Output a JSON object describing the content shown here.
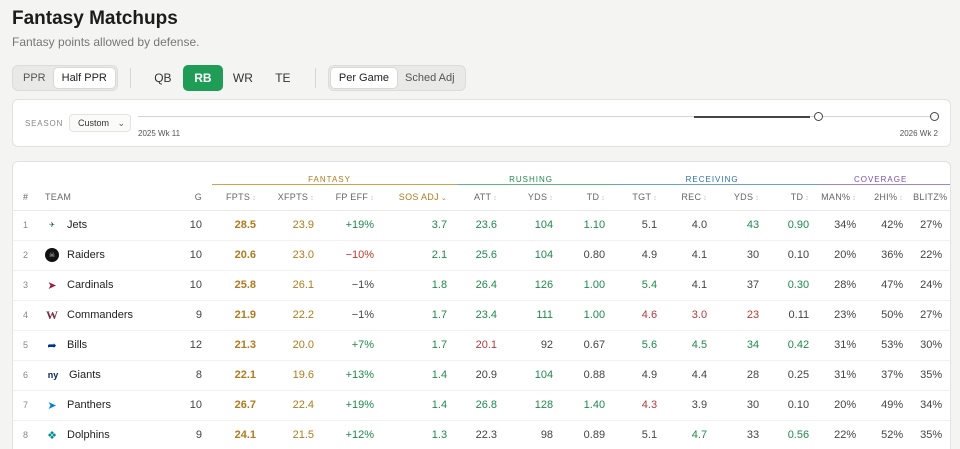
{
  "header": {
    "title": "Fantasy Matchups",
    "subtitle": "Fantasy points allowed by defense."
  },
  "toolbar": {
    "scoring": [
      {
        "label": "PPR",
        "active": false
      },
      {
        "label": "Half PPR",
        "active": true
      }
    ],
    "positions": [
      {
        "label": "QB",
        "active": false
      },
      {
        "label": "RB",
        "active": true
      },
      {
        "label": "WR",
        "active": false
      },
      {
        "label": "TE",
        "active": false
      }
    ],
    "mode": [
      {
        "label": "Per Game",
        "active": true
      },
      {
        "label": "Sched Adj",
        "active": false
      }
    ],
    "accent": "#1f9d57"
  },
  "season": {
    "label": "SEASON",
    "selected": "Custom",
    "range_min_label": "2025 Wk 11",
    "range_max_label": "2026 Wk 2"
  },
  "table": {
    "groups": {
      "fantasy": "FANTASY",
      "rushing": "RUSHING",
      "receiving": "RECEIVING",
      "coverage": "COVERAGE"
    },
    "columns": {
      "rank": "#",
      "team": "TEAM",
      "g": "G",
      "fpts": "FPTS",
      "xfpts": "XFPTS",
      "fpeff": "FP EFF",
      "sosadj": "SOS ADJ",
      "att": "ATT",
      "rush_yds": "YDS",
      "rush_td": "TD",
      "tgt": "TGT",
      "rec": "REC",
      "rec_yds": "YDS",
      "rec_td": "TD",
      "man": "MAN%",
      "twohi": "2HI%",
      "blitz": "BLITZ%"
    },
    "rows": [
      {
        "rank": "1",
        "team": "Jets",
        "logo": "jets-logo",
        "g": "10",
        "fpts": "28.5",
        "xfpts": "23.9",
        "fpeff": "+19%",
        "sosadj": "3.7",
        "att": "23.6",
        "rush_yds": "104",
        "rush_td": "1.10",
        "tgt": "5.1",
        "rec": "4.0",
        "rec_yds": "43",
        "rec_td": "0.90",
        "man": "34%",
        "twohi": "42%",
        "blitz": "27%"
      },
      {
        "rank": "2",
        "team": "Raiders",
        "logo": "raiders-logo",
        "g": "10",
        "fpts": "20.6",
        "xfpts": "23.0",
        "fpeff": "−10%",
        "sosadj": "2.1",
        "att": "25.6",
        "rush_yds": "104",
        "rush_td": "0.80",
        "tgt": "4.9",
        "rec": "4.1",
        "rec_yds": "30",
        "rec_td": "0.10",
        "man": "20%",
        "twohi": "36%",
        "blitz": "22%"
      },
      {
        "rank": "3",
        "team": "Cardinals",
        "logo": "cardinals-logo",
        "g": "10",
        "fpts": "25.8",
        "xfpts": "26.1",
        "fpeff": "−1%",
        "sosadj": "1.8",
        "att": "26.4",
        "rush_yds": "126",
        "rush_td": "1.00",
        "tgt": "5.4",
        "rec": "4.1",
        "rec_yds": "37",
        "rec_td": "0.30",
        "man": "28%",
        "twohi": "47%",
        "blitz": "24%"
      },
      {
        "rank": "4",
        "team": "Commanders",
        "logo": "commanders-logo",
        "g": "9",
        "fpts": "21.9",
        "xfpts": "22.2",
        "fpeff": "−1%",
        "sosadj": "1.7",
        "att": "23.4",
        "rush_yds": "111",
        "rush_td": "1.00",
        "tgt": "4.6",
        "rec": "3.0",
        "rec_yds": "23",
        "rec_td": "0.11",
        "man": "23%",
        "twohi": "50%",
        "blitz": "27%"
      },
      {
        "rank": "5",
        "team": "Bills",
        "logo": "bills-logo",
        "g": "12",
        "fpts": "21.3",
        "xfpts": "20.0",
        "fpeff": "+7%",
        "sosadj": "1.7",
        "att": "20.1",
        "rush_yds": "92",
        "rush_td": "0.67",
        "tgt": "5.6",
        "rec": "4.5",
        "rec_yds": "34",
        "rec_td": "0.42",
        "man": "31%",
        "twohi": "53%",
        "blitz": "30%"
      },
      {
        "rank": "6",
        "team": "Giants",
        "logo": "giants-logo",
        "g": "8",
        "fpts": "22.1",
        "xfpts": "19.6",
        "fpeff": "+13%",
        "sosadj": "1.4",
        "att": "20.9",
        "rush_yds": "104",
        "rush_td": "0.88",
        "tgt": "4.9",
        "rec": "4.4",
        "rec_yds": "28",
        "rec_td": "0.25",
        "man": "31%",
        "twohi": "37%",
        "blitz": "35%"
      },
      {
        "rank": "7",
        "team": "Panthers",
        "logo": "panthers-logo",
        "g": "10",
        "fpts": "26.7",
        "xfpts": "22.4",
        "fpeff": "+19%",
        "sosadj": "1.4",
        "att": "26.8",
        "rush_yds": "128",
        "rush_td": "1.40",
        "tgt": "4.3",
        "rec": "3.9",
        "rec_yds": "30",
        "rec_td": "0.10",
        "man": "20%",
        "twohi": "49%",
        "blitz": "34%"
      },
      {
        "rank": "8",
        "team": "Dolphins",
        "logo": "dolphins-logo",
        "g": "9",
        "fpts": "24.1",
        "xfpts": "21.5",
        "fpeff": "+12%",
        "sosadj": "1.3",
        "att": "22.3",
        "rush_yds": "98",
        "rush_td": "0.89",
        "tgt": "5.1",
        "rec": "4.7",
        "rec_yds": "33",
        "rec_td": "0.56",
        "man": "22%",
        "twohi": "52%",
        "blitz": "35%"
      }
    ]
  }
}
